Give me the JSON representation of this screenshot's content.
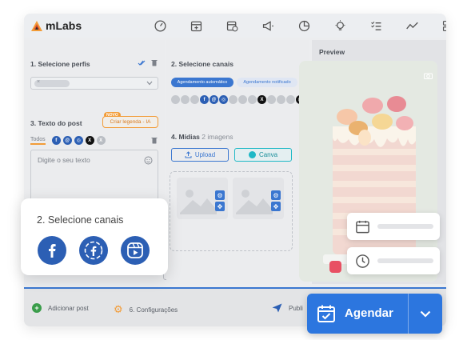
{
  "brand": {
    "name": "mLabs"
  },
  "toolbar": {
    "icons": [
      "dashboard-icon",
      "calendar-add-icon",
      "calendar-clock-icon",
      "megaphone-icon",
      "pie-chart-icon",
      "lightbulb-icon",
      "checklist-icon",
      "trend-icon",
      "apps-icon"
    ]
  },
  "profiles": {
    "title": "1. Selecione perfis"
  },
  "post_text": {
    "title": "3. Texto do post",
    "new_badge": "NOVO",
    "ai_button": "Criar legenda - IA",
    "tab_all": "Todos",
    "placeholder": "Digite o seu texto"
  },
  "channels": {
    "title": "2. Selecione canais",
    "option_auto": "Agendamento automático",
    "option_notified": "Agendamento notificado"
  },
  "media": {
    "title": "4. Mídias",
    "count": "2 imagens",
    "upload_label": "Upload",
    "canva_label": "Canva"
  },
  "preview": {
    "title": "Preview"
  },
  "footer": {
    "add_post": "Adicionar post",
    "settings": "6. Configurações",
    "publish_partial": "Publi"
  },
  "popup": {
    "title": "2. Selecione canais"
  },
  "cta": {
    "label": "Agendar"
  },
  "colors": {
    "accent": "#2c76df",
    "brand_orange": "#f29c38",
    "popup_icon_bg": "#2c5fb4"
  }
}
